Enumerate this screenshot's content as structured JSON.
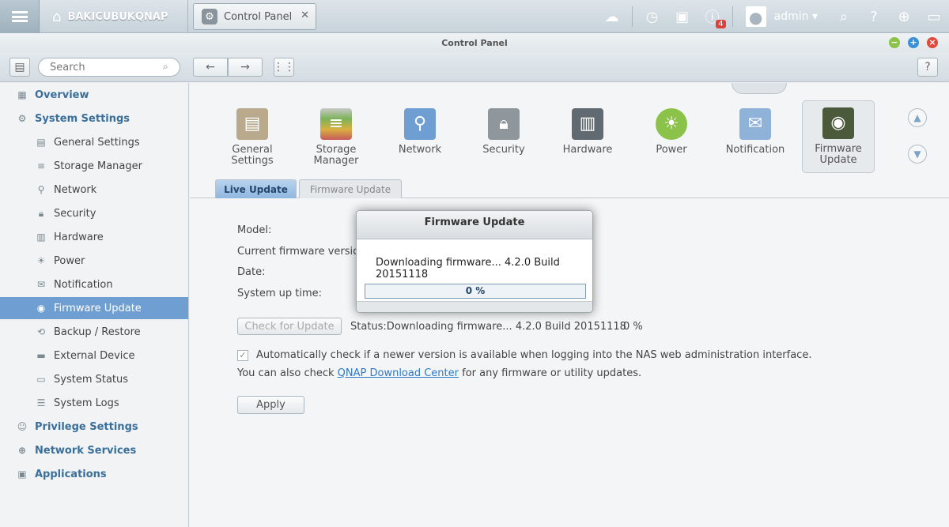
{
  "topbar": {
    "nas_name": "BAKICUBUKQNAP",
    "app_tab_label": "Control Panel",
    "notifications_count": "4",
    "user": "admin"
  },
  "window": {
    "title": "Control Panel"
  },
  "toolbar": {
    "search_placeholder": "Search"
  },
  "sidebar": {
    "items": [
      {
        "label": "Overview",
        "icon": "overview-icon"
      },
      {
        "label": "System Settings",
        "icon": "gear-icon"
      },
      {
        "label": "General Settings",
        "icon": "clipboard-icon"
      },
      {
        "label": "Storage Manager",
        "icon": "storage-icon"
      },
      {
        "label": "Network",
        "icon": "network-icon"
      },
      {
        "label": "Security",
        "icon": "lock-icon"
      },
      {
        "label": "Hardware",
        "icon": "hardware-icon"
      },
      {
        "label": "Power",
        "icon": "bulb-icon"
      },
      {
        "label": "Notification",
        "icon": "message-icon"
      },
      {
        "label": "Firmware Update",
        "icon": "chip-icon"
      },
      {
        "label": "Backup / Restore",
        "icon": "backup-icon"
      },
      {
        "label": "External Device",
        "icon": "drive-icon"
      },
      {
        "label": "System Status",
        "icon": "monitor-icon"
      },
      {
        "label": "System Logs",
        "icon": "log-icon"
      },
      {
        "label": "Privilege Settings",
        "icon": "user-icon"
      },
      {
        "label": "Network Services",
        "icon": "globe-icon"
      },
      {
        "label": "Applications",
        "icon": "apps-icon"
      }
    ]
  },
  "iconbar": {
    "items": [
      {
        "line1": "General",
        "line2": "Settings"
      },
      {
        "line1": "Storage",
        "line2": "Manager"
      },
      {
        "line1": "Network",
        "line2": ""
      },
      {
        "line1": "Security",
        "line2": ""
      },
      {
        "line1": "Hardware",
        "line2": ""
      },
      {
        "line1": "Power",
        "line2": ""
      },
      {
        "line1": "Notification",
        "line2": ""
      },
      {
        "line1": "Firmware",
        "line2": "Update"
      }
    ]
  },
  "subtabs": {
    "live_update": "Live Update",
    "firmware_update": "Firmware Update"
  },
  "main": {
    "model_label": "Model:",
    "current_fw_label": "Current firmware version:",
    "date_label": "Date:",
    "uptime_label": "System up time:",
    "check_button": "Check for Update",
    "status_text": "Status:Downloading firmware... 4.2.0 Build 20151118",
    "status_percent": "0 %",
    "auto_check_text": "Automatically check if a newer version is available when logging into the NAS web administration interface.",
    "also_prefix": "You can also check ",
    "download_center_link": "QNAP Download Center",
    "also_suffix": " for any firmware or utility updates.",
    "apply_button": "Apply"
  },
  "modal": {
    "title": "Firmware Update",
    "message": "Downloading firmware... 4.2.0 Build 20151118",
    "progress_text": "0 %",
    "progress_fraction": 0
  }
}
